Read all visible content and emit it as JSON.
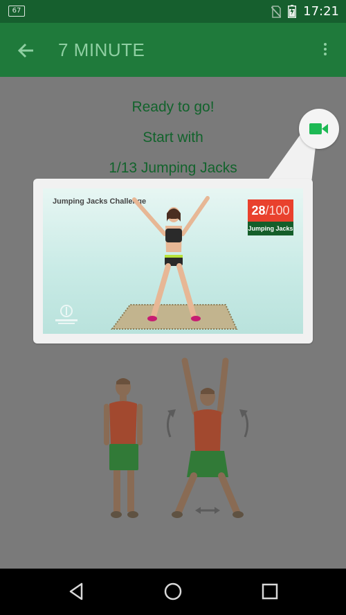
{
  "status_bar": {
    "badge": "67",
    "time": "17:21",
    "icons": [
      "no-sim-icon",
      "battery-charging-icon"
    ]
  },
  "app_bar": {
    "title": "7 MINUTE",
    "back_icon": "arrow-left-icon",
    "menu_icon": "more-vert-icon"
  },
  "main": {
    "ready": "Ready to go!",
    "start_with": "Start with",
    "exercise": "1/13 Jumping Jacks",
    "video_button_icon": "videocam-icon",
    "accent_color": "#1db954"
  },
  "video_preview": {
    "caption": "Jumping Jacks Challenge",
    "counter_current": "28",
    "counter_total": "/100",
    "counter_label": "Jumping Jacks"
  },
  "nav_bar": {
    "icons": [
      "back-triangle-icon",
      "home-circle-icon",
      "recents-square-icon"
    ]
  }
}
